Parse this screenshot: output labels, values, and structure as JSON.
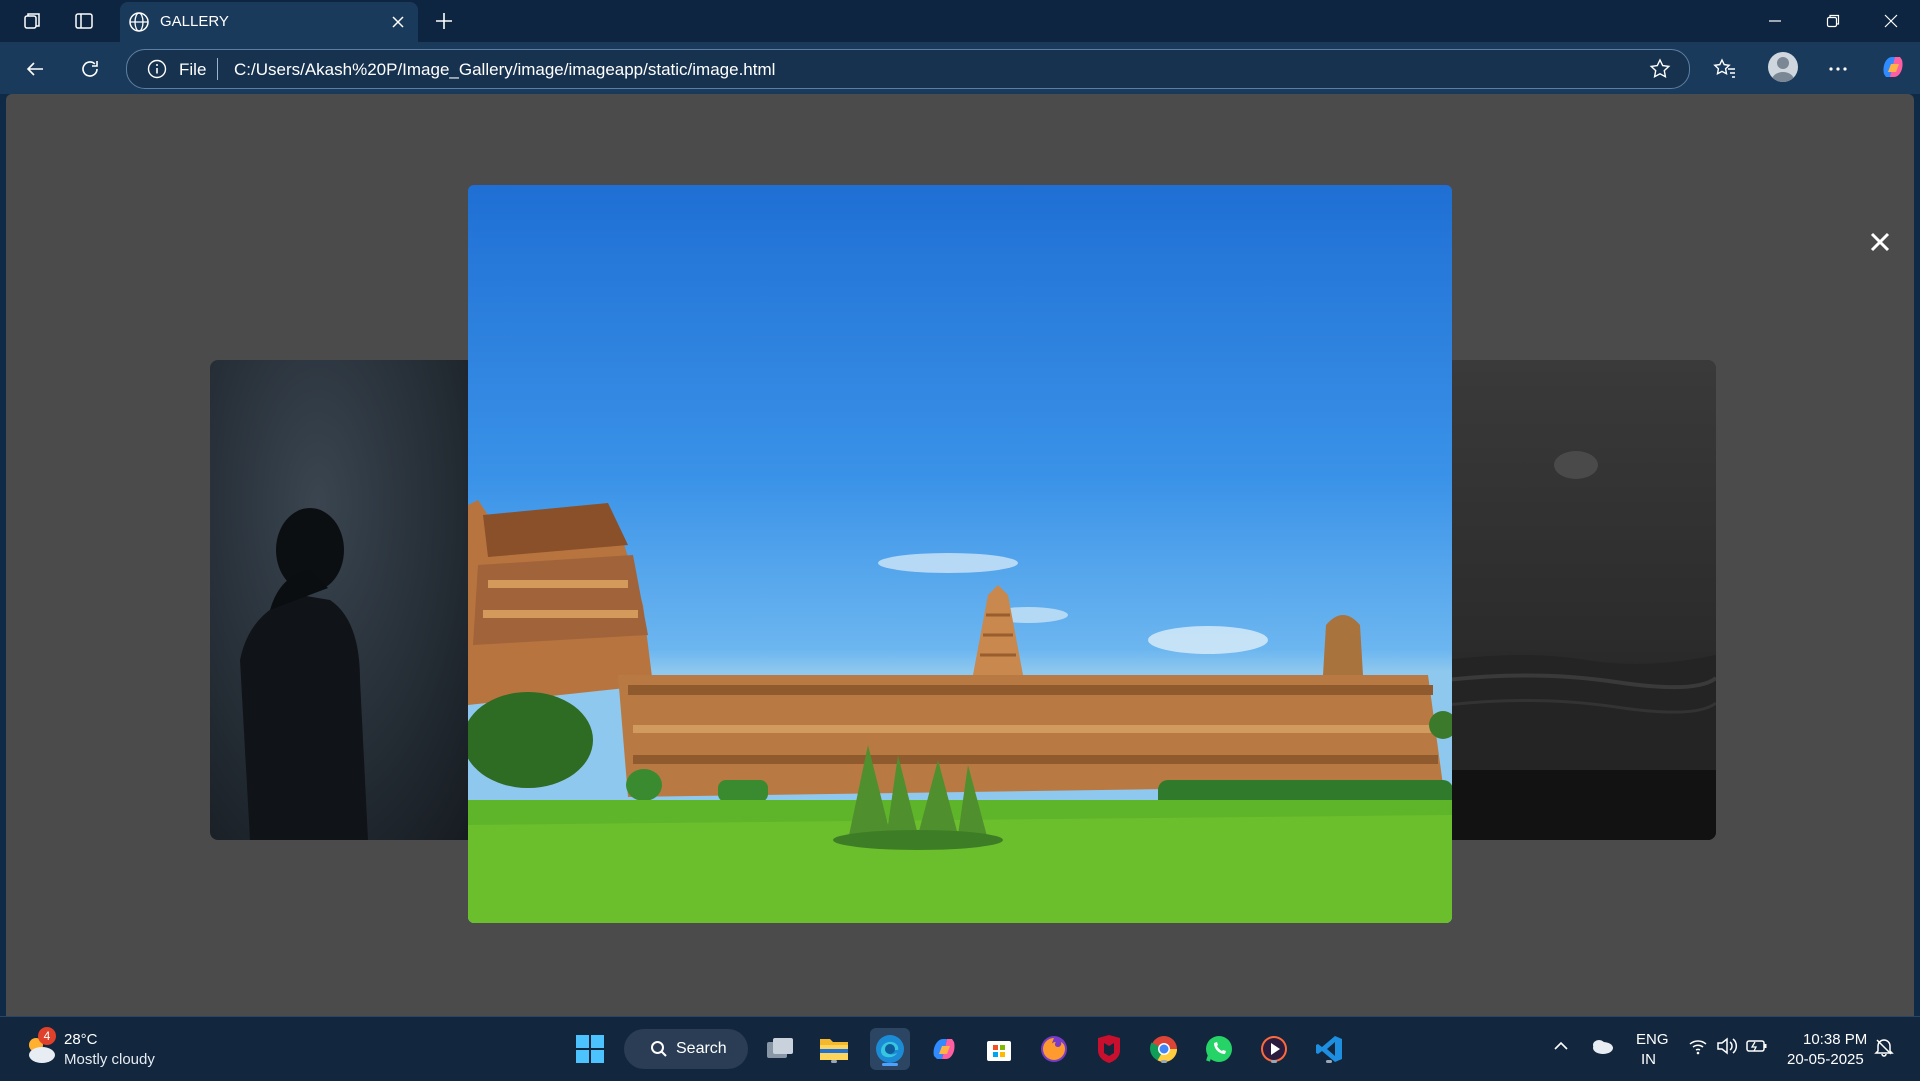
{
  "browser": {
    "tab_title": "GALLERY",
    "address_scheme": "File",
    "url": "C:/Users/Akash%20P/Image_Gallery/image/imageapp/static/image.html"
  },
  "taskbar": {
    "weather_badge": "4",
    "weather_temp": "28°C",
    "weather_condition": "Mostly cloudy",
    "search_label": "Search",
    "language_line1": "ENG",
    "language_line2": "IN",
    "time": "10:38 PM",
    "date": "20-05-2025",
    "apps": [
      "windows-start",
      "search",
      "task-view",
      "file-explorer",
      "edge",
      "copilot",
      "microsoft-store",
      "firefox",
      "mcafee",
      "chrome",
      "whatsapp",
      "media-player",
      "vscode"
    ]
  },
  "colors": {
    "page_bg": "#4b4b4b",
    "chrome_bg": "#1a3a5c",
    "taskbar_bg": "#12263e",
    "accent": "#4ea1ff"
  }
}
